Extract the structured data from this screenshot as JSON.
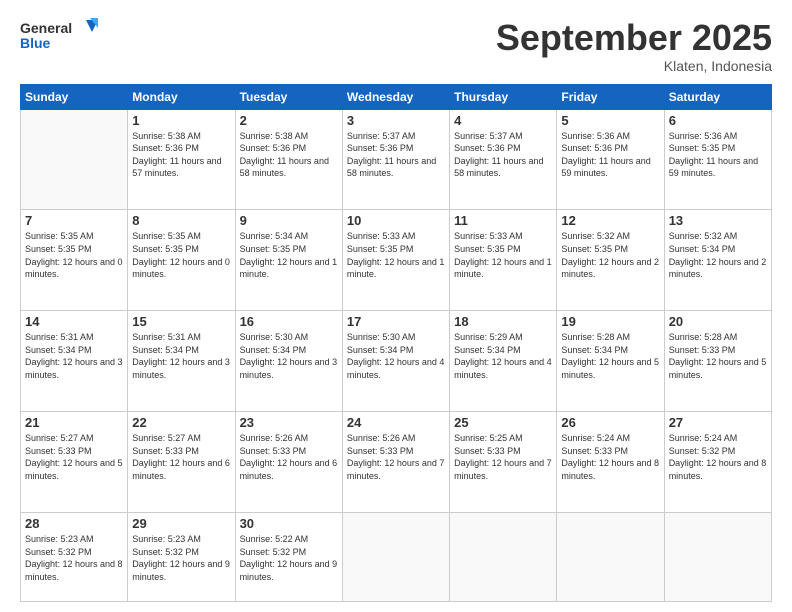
{
  "header": {
    "logo_general": "General",
    "logo_blue": "Blue",
    "month_title": "September 2025",
    "subtitle": "Klaten, Indonesia"
  },
  "weekdays": [
    "Sunday",
    "Monday",
    "Tuesday",
    "Wednesday",
    "Thursday",
    "Friday",
    "Saturday"
  ],
  "weeks": [
    [
      {
        "day": "",
        "empty": true
      },
      {
        "day": "1",
        "sunrise": "Sunrise: 5:38 AM",
        "sunset": "Sunset: 5:36 PM",
        "daylight": "Daylight: 11 hours and 57 minutes."
      },
      {
        "day": "2",
        "sunrise": "Sunrise: 5:38 AM",
        "sunset": "Sunset: 5:36 PM",
        "daylight": "Daylight: 11 hours and 58 minutes."
      },
      {
        "day": "3",
        "sunrise": "Sunrise: 5:37 AM",
        "sunset": "Sunset: 5:36 PM",
        "daylight": "Daylight: 11 hours and 58 minutes."
      },
      {
        "day": "4",
        "sunrise": "Sunrise: 5:37 AM",
        "sunset": "Sunset: 5:36 PM",
        "daylight": "Daylight: 11 hours and 58 minutes."
      },
      {
        "day": "5",
        "sunrise": "Sunrise: 5:36 AM",
        "sunset": "Sunset: 5:36 PM",
        "daylight": "Daylight: 11 hours and 59 minutes."
      },
      {
        "day": "6",
        "sunrise": "Sunrise: 5:36 AM",
        "sunset": "Sunset: 5:35 PM",
        "daylight": "Daylight: 11 hours and 59 minutes."
      }
    ],
    [
      {
        "day": "7",
        "sunrise": "Sunrise: 5:35 AM",
        "sunset": "Sunset: 5:35 PM",
        "daylight": "Daylight: 12 hours and 0 minutes."
      },
      {
        "day": "8",
        "sunrise": "Sunrise: 5:35 AM",
        "sunset": "Sunset: 5:35 PM",
        "daylight": "Daylight: 12 hours and 0 minutes."
      },
      {
        "day": "9",
        "sunrise": "Sunrise: 5:34 AM",
        "sunset": "Sunset: 5:35 PM",
        "daylight": "Daylight: 12 hours and 1 minute."
      },
      {
        "day": "10",
        "sunrise": "Sunrise: 5:33 AM",
        "sunset": "Sunset: 5:35 PM",
        "daylight": "Daylight: 12 hours and 1 minute."
      },
      {
        "day": "11",
        "sunrise": "Sunrise: 5:33 AM",
        "sunset": "Sunset: 5:35 PM",
        "daylight": "Daylight: 12 hours and 1 minute."
      },
      {
        "day": "12",
        "sunrise": "Sunrise: 5:32 AM",
        "sunset": "Sunset: 5:35 PM",
        "daylight": "Daylight: 12 hours and 2 minutes."
      },
      {
        "day": "13",
        "sunrise": "Sunrise: 5:32 AM",
        "sunset": "Sunset: 5:34 PM",
        "daylight": "Daylight: 12 hours and 2 minutes."
      }
    ],
    [
      {
        "day": "14",
        "sunrise": "Sunrise: 5:31 AM",
        "sunset": "Sunset: 5:34 PM",
        "daylight": "Daylight: 12 hours and 3 minutes."
      },
      {
        "day": "15",
        "sunrise": "Sunrise: 5:31 AM",
        "sunset": "Sunset: 5:34 PM",
        "daylight": "Daylight: 12 hours and 3 minutes."
      },
      {
        "day": "16",
        "sunrise": "Sunrise: 5:30 AM",
        "sunset": "Sunset: 5:34 PM",
        "daylight": "Daylight: 12 hours and 3 minutes."
      },
      {
        "day": "17",
        "sunrise": "Sunrise: 5:30 AM",
        "sunset": "Sunset: 5:34 PM",
        "daylight": "Daylight: 12 hours and 4 minutes."
      },
      {
        "day": "18",
        "sunrise": "Sunrise: 5:29 AM",
        "sunset": "Sunset: 5:34 PM",
        "daylight": "Daylight: 12 hours and 4 minutes."
      },
      {
        "day": "19",
        "sunrise": "Sunrise: 5:28 AM",
        "sunset": "Sunset: 5:34 PM",
        "daylight": "Daylight: 12 hours and 5 minutes."
      },
      {
        "day": "20",
        "sunrise": "Sunrise: 5:28 AM",
        "sunset": "Sunset: 5:33 PM",
        "daylight": "Daylight: 12 hours and 5 minutes."
      }
    ],
    [
      {
        "day": "21",
        "sunrise": "Sunrise: 5:27 AM",
        "sunset": "Sunset: 5:33 PM",
        "daylight": "Daylight: 12 hours and 5 minutes."
      },
      {
        "day": "22",
        "sunrise": "Sunrise: 5:27 AM",
        "sunset": "Sunset: 5:33 PM",
        "daylight": "Daylight: 12 hours and 6 minutes."
      },
      {
        "day": "23",
        "sunrise": "Sunrise: 5:26 AM",
        "sunset": "Sunset: 5:33 PM",
        "daylight": "Daylight: 12 hours and 6 minutes."
      },
      {
        "day": "24",
        "sunrise": "Sunrise: 5:26 AM",
        "sunset": "Sunset: 5:33 PM",
        "daylight": "Daylight: 12 hours and 7 minutes."
      },
      {
        "day": "25",
        "sunrise": "Sunrise: 5:25 AM",
        "sunset": "Sunset: 5:33 PM",
        "daylight": "Daylight: 12 hours and 7 minutes."
      },
      {
        "day": "26",
        "sunrise": "Sunrise: 5:24 AM",
        "sunset": "Sunset: 5:33 PM",
        "daylight": "Daylight: 12 hours and 8 minutes."
      },
      {
        "day": "27",
        "sunrise": "Sunrise: 5:24 AM",
        "sunset": "Sunset: 5:32 PM",
        "daylight": "Daylight: 12 hours and 8 minutes."
      }
    ],
    [
      {
        "day": "28",
        "sunrise": "Sunrise: 5:23 AM",
        "sunset": "Sunset: 5:32 PM",
        "daylight": "Daylight: 12 hours and 8 minutes."
      },
      {
        "day": "29",
        "sunrise": "Sunrise: 5:23 AM",
        "sunset": "Sunset: 5:32 PM",
        "daylight": "Daylight: 12 hours and 9 minutes."
      },
      {
        "day": "30",
        "sunrise": "Sunrise: 5:22 AM",
        "sunset": "Sunset: 5:32 PM",
        "daylight": "Daylight: 12 hours and 9 minutes."
      },
      {
        "day": "",
        "empty": true
      },
      {
        "day": "",
        "empty": true
      },
      {
        "day": "",
        "empty": true
      },
      {
        "day": "",
        "empty": true
      }
    ]
  ]
}
